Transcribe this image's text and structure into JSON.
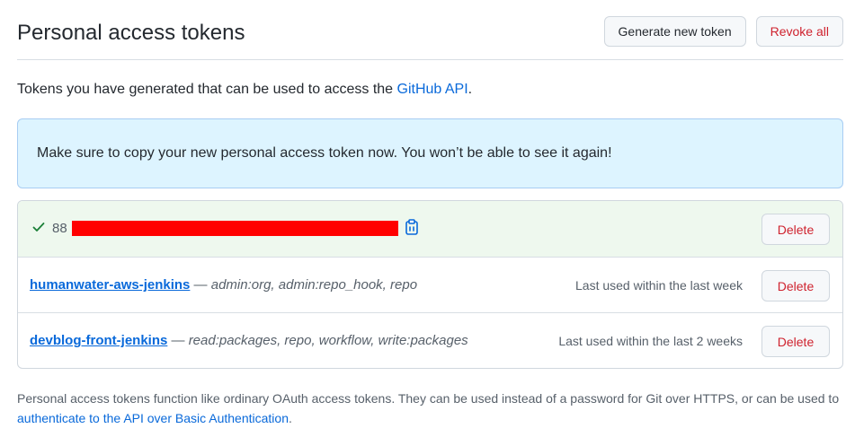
{
  "header": {
    "title": "Personal access tokens",
    "generate_label": "Generate new token",
    "revoke_label": "Revoke all"
  },
  "description": {
    "text": "Tokens you have generated that can be used to access the ",
    "link": "GitHub API",
    "suffix": "."
  },
  "flash": {
    "message": "Make sure to copy your new personal access token now. You won’t be able to see it again!"
  },
  "new_token": {
    "prefix": "88",
    "delete_label": "Delete"
  },
  "tokens": [
    {
      "name": "humanwater-aws-jenkins",
      "separator": " — ",
      "scopes": "admin:org, admin:repo_hook, repo",
      "last_used": "Last used within the last week",
      "delete_label": "Delete"
    },
    {
      "name": "devblog-front-jenkins",
      "separator": " — ",
      "scopes": "read:packages, repo, workflow, write:packages",
      "last_used": "Last used within the last 2 weeks",
      "delete_label": "Delete"
    }
  ],
  "footer": {
    "text": "Personal access tokens function like ordinary OAuth access tokens. They can be used instead of a password for Git over HTTPS, or can be used to ",
    "link": "authenticate to the API over Basic Authentication",
    "suffix": "."
  },
  "colors": {
    "link": "#0969da",
    "danger": "#cf222e",
    "flash_bg": "#ddf4ff",
    "success": "#1a7f37",
    "redaction": "#ff0000"
  },
  "icons": {
    "check": "check-icon",
    "copy": "clipboard-icon"
  }
}
